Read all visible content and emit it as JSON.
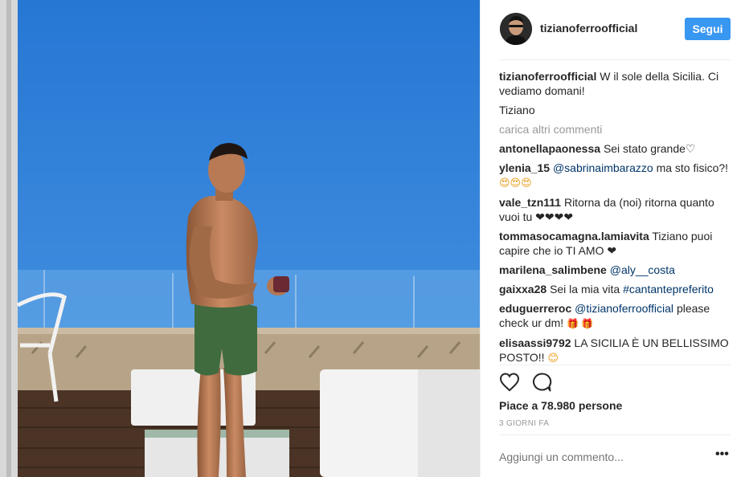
{
  "post": {
    "username": "tizianoferroofficial",
    "follow_label": "Segui",
    "caption_user": "tizianoferroofficial",
    "caption_text": "W il sole della Sicilia. Ci vediamo domani!",
    "caption_sign": "Tiziano",
    "load_more": "carica altri commenti",
    "likes": "Piace a 78.980 persone",
    "time": "3 GIORNI FA",
    "add_comment_placeholder": "Aggiungi un commento...",
    "more_options": "•••"
  },
  "comments": [
    {
      "user": "antonellapaonessa",
      "text": "Sei stato grande♡"
    },
    {
      "user": "ylenia_15",
      "mention": "@sabrinaimbarazzo",
      "text": "ma sto fisico?!",
      "emoji": "😍😍😍"
    },
    {
      "user": "vale_tzn111",
      "text": "Ritorna da (noi) ritorna quanto vuoi tu",
      "emoji": "❤❤❤❤"
    },
    {
      "user": "tommasocamagna.lamiavita",
      "text": "Tiziano puoi capire che io TI AMO",
      "emoji": "❤"
    },
    {
      "user": "marilena_salimbene",
      "mention": "@aly__costa"
    },
    {
      "user": "gaixxa28",
      "text": "Sei la mia vita",
      "hashtag": "#cantantepreferito"
    },
    {
      "user": "eduguerreroc",
      "mention": "@tizianoferroofficial",
      "text": "please check ur dm!",
      "emoji": "🎁 🎁"
    },
    {
      "user": "elisaassi9792",
      "text": "LA SICILIA È UN BELLISSIMO POSTO!!",
      "emoji": "😊"
    }
  ],
  "icons": {
    "like": "heart-outline-icon",
    "comment": "speech-bubble-icon"
  },
  "colors": {
    "accent": "#3897f0",
    "mention": "#003569",
    "muted": "#999999",
    "sky": "#2f7fd6"
  }
}
